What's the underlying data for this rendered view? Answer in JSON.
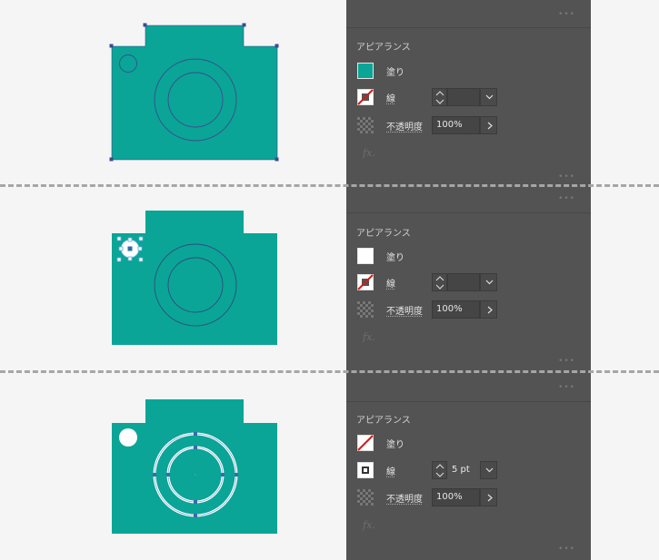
{
  "colors": {
    "camera_teal": "#0aa596",
    "canvas_bg": "#f5f5f5",
    "panel_bg": "#535353",
    "dash": "#a6a6a6"
  },
  "panels": [
    {
      "title": "アピアランス",
      "fill_label": "塗り",
      "fill_swatch": "teal",
      "stroke_label": "線",
      "stroke_swatch": "none",
      "stroke_value": "",
      "opacity_label": "不透明度",
      "opacity_value": "100%",
      "fx": "fx."
    },
    {
      "title": "アピアランス",
      "fill_label": "塗り",
      "fill_swatch": "white",
      "stroke_label": "線",
      "stroke_swatch": "none",
      "stroke_value": "",
      "opacity_label": "不透明度",
      "opacity_value": "100%",
      "fx": "fx."
    },
    {
      "title": "アピアランス",
      "fill_label": "塗り",
      "fill_swatch": "none",
      "stroke_label": "線",
      "stroke_swatch": "white-square",
      "stroke_value": "5 pt",
      "opacity_label": "不透明度",
      "opacity_value": "100%",
      "fx": "fx."
    }
  ],
  "more_icon": "more-dots-icon"
}
